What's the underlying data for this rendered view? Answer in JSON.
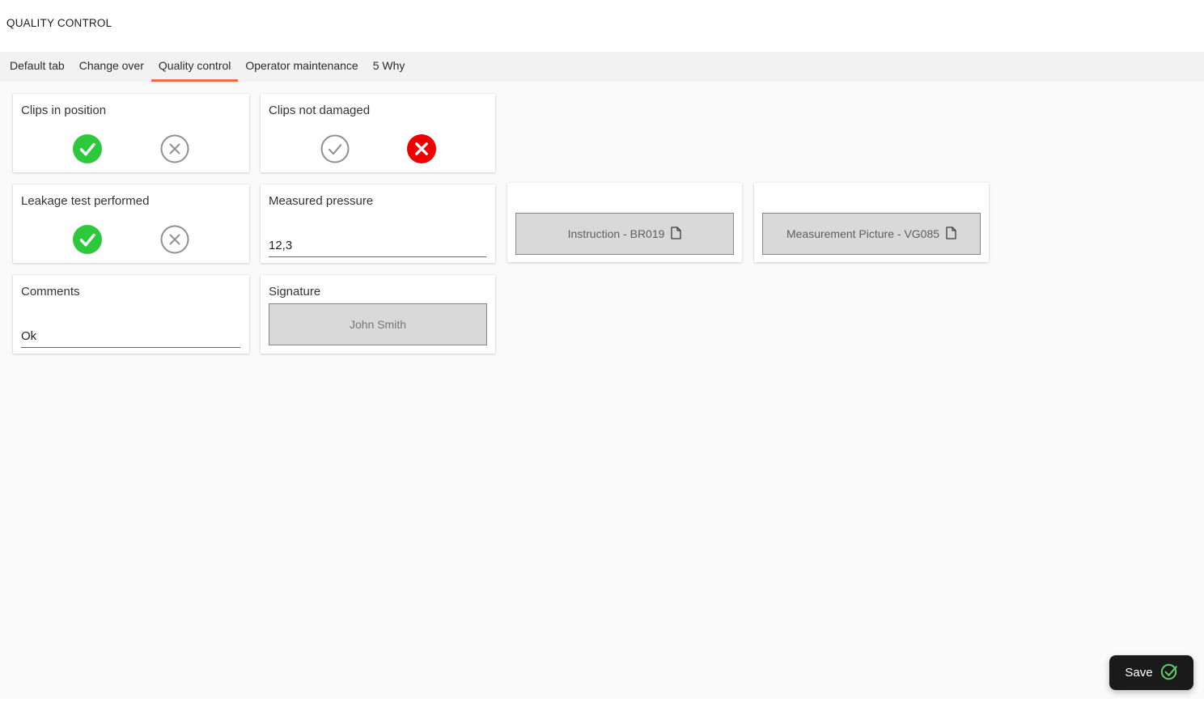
{
  "header": {
    "title": "QUALITY CONTROL"
  },
  "tabs": [
    {
      "label": "Default tab",
      "active": false
    },
    {
      "label": "Change over",
      "active": false
    },
    {
      "label": "Quality control",
      "active": true
    },
    {
      "label": "Operator maintenance",
      "active": false
    },
    {
      "label": "5 Why",
      "active": false
    }
  ],
  "cards": {
    "clips_in_position": {
      "label": "Clips in position",
      "state": "pass-selected"
    },
    "clips_not_damaged": {
      "label": "Clips not damaged",
      "state": "fail-selected"
    },
    "leakage_test_performed": {
      "label": "Leakage test performed",
      "state": "pass-selected"
    },
    "measured_pressure": {
      "label": "Measured pressure",
      "value": "12,3"
    },
    "instruction": {
      "button_label": "Instruction - BR019",
      "icon": "document-icon"
    },
    "measurement_picture": {
      "button_label": "Measurement Picture - VG085",
      "icon": "document-icon"
    },
    "comments": {
      "label": "Comments",
      "value": "Ok"
    },
    "signature": {
      "label": "Signature",
      "button_label": "John Smith"
    }
  },
  "footer": {
    "save_label": "Save",
    "save_icon": "circle-check-icon"
  },
  "colors": {
    "accent_orange": "#ED6B3D",
    "pass_green": "#2DC83C",
    "fail_red": "#EE0000",
    "unselected_gray": "#8F8F8F",
    "tabbar_bg": "#F2F2F2",
    "content_bg": "#FAFAFA",
    "button_gray": "#D9D9D9",
    "save_button_bg": "#1A1A1A",
    "save_check_green": "#5FD068"
  }
}
